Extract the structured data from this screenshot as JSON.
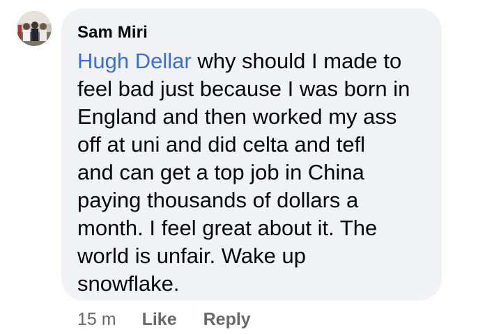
{
  "comment": {
    "author": "Sam Miri",
    "mention": "Hugh Dellar",
    "text": " why should I made to\nfeel bad just because I was born in\nEngland and then worked my ass\noff at uni and did celta and tefl\nand can get a top job in China\npaying thousands of dollars a\nmonth. I feel great about it. The\nworld is unfair. Wake up\nsnowflake.",
    "timestamp": "15 m",
    "like_label": "Like",
    "reply_label": "Reply"
  },
  "colors": {
    "bubble": "#f0f2f5",
    "mention": "#3b6ed6",
    "meta": "#65676b"
  }
}
